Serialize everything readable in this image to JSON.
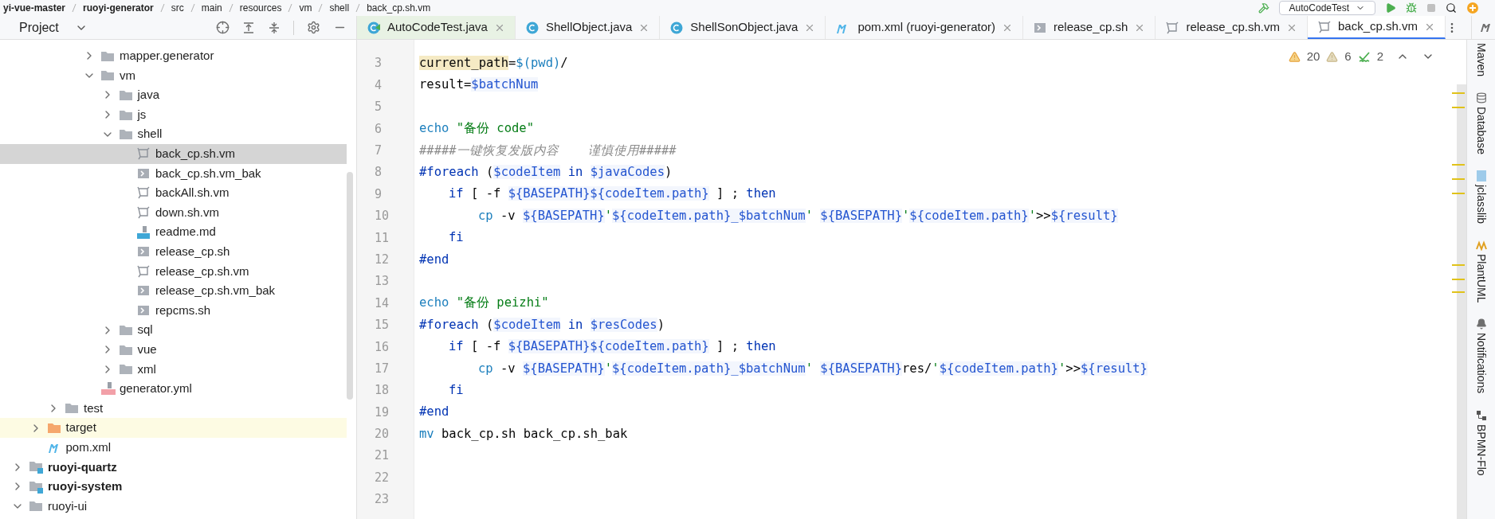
{
  "breadcrumb": [
    "yi-vue-master",
    "ruoyi-generator",
    "src",
    "main",
    "resources",
    "vm",
    "shell",
    "back_cp.sh.vm"
  ],
  "run_config": "AutoCodeTest",
  "project_panel": {
    "title": "Project"
  },
  "tree": [
    {
      "children": [
        {
          "children": [
            {
              "children": [
                {
                  "children": [
                    {
                      "label": "mapper.generator",
                      "kind": "folder",
                      "expanded": false,
                      "selected": false
                    },
                    {
                      "label": "vm",
                      "kind": "folder",
                      "expanded": true,
                      "selected": false,
                      "children": [
                        {
                          "label": "java",
                          "kind": "folder",
                          "expanded": false,
                          "selected": false
                        },
                        {
                          "label": "js",
                          "kind": "folder",
                          "expanded": false,
                          "selected": false
                        },
                        {
                          "label": "shell",
                          "kind": "folder",
                          "expanded": true,
                          "selected": false,
                          "children": [
                            {
                              "label": "back_cp.sh.vm",
                              "kind": "velocity",
                              "selected": true
                            },
                            {
                              "label": "back_cp.sh.vm_bak",
                              "kind": "shell",
                              "selected": false
                            },
                            {
                              "label": "backAll.sh.vm",
                              "kind": "velocity",
                              "selected": false
                            },
                            {
                              "label": "down.sh.vm",
                              "kind": "velocity",
                              "selected": false
                            },
                            {
                              "label": "readme.md",
                              "kind": "markdown",
                              "selected": false
                            },
                            {
                              "label": "release_cp.sh",
                              "kind": "shell",
                              "selected": false
                            },
                            {
                              "label": "release_cp.sh.vm",
                              "kind": "velocity",
                              "selected": false
                            },
                            {
                              "label": "release_cp.sh.vm_bak",
                              "kind": "shell",
                              "selected": false
                            },
                            {
                              "label": "repcms.sh",
                              "kind": "shell",
                              "selected": false
                            }
                          ]
                        },
                        {
                          "label": "sql",
                          "kind": "folder",
                          "expanded": false,
                          "selected": false
                        },
                        {
                          "label": "vue",
                          "kind": "folder",
                          "expanded": false,
                          "selected": false
                        },
                        {
                          "label": "xml",
                          "kind": "folder",
                          "expanded": false,
                          "selected": false
                        }
                      ]
                    },
                    {
                      "label": "generator.yml",
                      "kind": "yaml",
                      "selected": false
                    }
                  ]
                }
              ]
            },
            {
              "label": "test",
              "kind": "folder",
              "expanded": false,
              "selected": false
            }
          ]
        },
        {
          "label": "target",
          "kind": "excluded",
          "expanded": false,
          "selected": false
        },
        {
          "label": "pom.xml",
          "kind": "maven",
          "selected": false
        }
      ]
    },
    {
      "label": "ruoyi-quartz",
      "kind": "module",
      "expanded": false,
      "selected": false
    },
    {
      "label": "ruoyi-system",
      "kind": "module",
      "expanded": false,
      "selected": false
    },
    {
      "label": "ruoyi-ui",
      "kind": "folder",
      "expanded": true,
      "selected": false
    }
  ],
  "tabs": [
    {
      "label": "AutoCodeTest.java",
      "kind": "java-test",
      "selected": false
    },
    {
      "label": "ShellObject.java",
      "kind": "java",
      "selected": false
    },
    {
      "label": "ShellSonObject.java",
      "kind": "java",
      "selected": false
    },
    {
      "label": "pom.xml (ruoyi-generator)",
      "kind": "maven",
      "selected": false
    },
    {
      "label": "release_cp.sh",
      "kind": "shell",
      "selected": false
    },
    {
      "label": "release_cp.sh.vm",
      "kind": "velocity",
      "selected": false
    },
    {
      "label": "back_cp.sh.vm",
      "kind": "velocity",
      "selected": true
    }
  ],
  "inspections": {
    "errors": "20",
    "warnings": "6",
    "typos": "2"
  },
  "code_lines": [
    {
      "number": "3",
      "tokens": [
        {
          "text": "current_path",
          "kind": "highlight"
        },
        {
          "text": "=",
          "kind": "plain"
        },
        {
          "text": "$(pwd)",
          "kind": "cmd"
        },
        {
          "text": "/",
          "kind": "plain"
        }
      ]
    },
    {
      "number": "4",
      "tokens": [
        {
          "text": "result=",
          "kind": "plain"
        },
        {
          "text": "$batchNum",
          "kind": "var"
        }
      ]
    },
    {
      "number": "5"
    },
    {
      "number": "6",
      "tokens": [
        {
          "text": "echo",
          "kind": "cmd"
        },
        {
          "text": " \"备份 code\"",
          "kind": "str"
        }
      ]
    },
    {
      "number": "7",
      "tokens": [
        {
          "text": "#####一键恢复发版内容    谨慎使用#####",
          "kind": "comment"
        }
      ]
    },
    {
      "number": "8",
      "tokens": [
        {
          "text": "#foreach",
          "kind": "kw"
        },
        {
          "text": " (",
          "kind": "plain"
        },
        {
          "text": "$codeItem",
          "kind": "var"
        },
        {
          "text": " in ",
          "kind": "kw"
        },
        {
          "text": "$javaCodes",
          "kind": "var"
        },
        {
          "text": ")",
          "kind": "plain"
        }
      ],
      "children": [
        {
          "number": "9",
          "tokens": [
            {
              "text": "if",
              "kind": "kw"
            },
            {
              "text": " [ -f ",
              "kind": "plain"
            },
            {
              "text": "${BASEPATH}${codeItem.path}",
              "kind": "var"
            },
            {
              "text": " ] ; ",
              "kind": "plain"
            },
            {
              "text": "then",
              "kind": "kw"
            }
          ],
          "children": [
            {
              "number": "10",
              "tokens": [
                {
                  "text": "cp",
                  "kind": "cmd"
                },
                {
                  "text": " -v ",
                  "kind": "plain"
                },
                {
                  "text": "${BASEPATH}",
                  "kind": "var"
                },
                {
                  "text": "'",
                  "kind": "str"
                },
                {
                  "text": "${codeItem.path}_$batchNum",
                  "kind": "var"
                },
                {
                  "text": "' ",
                  "kind": "str"
                },
                {
                  "text": "${BASEPATH}",
                  "kind": "var"
                },
                {
                  "text": "'",
                  "kind": "str"
                },
                {
                  "text": "${codeItem.path}",
                  "kind": "var"
                },
                {
                  "text": "'",
                  "kind": "str"
                },
                {
                  "text": ">>",
                  "kind": "plain"
                },
                {
                  "text": "${result}",
                  "kind": "var"
                }
              ]
            }
          ]
        },
        {
          "number": "11",
          "tokens": [
            {
              "text": "fi",
              "kind": "kw"
            }
          ]
        }
      ]
    },
    {
      "number": "12",
      "tokens": [
        {
          "text": "#end",
          "kind": "kw"
        }
      ]
    },
    {
      "number": "13"
    },
    {
      "number": "14",
      "tokens": [
        {
          "text": "echo",
          "kind": "cmd"
        },
        {
          "text": " \"备份 peizhi\"",
          "kind": "str"
        }
      ]
    },
    {
      "number": "15",
      "tokens": [
        {
          "text": "#foreach",
          "kind": "kw"
        },
        {
          "text": " (",
          "kind": "plain"
        },
        {
          "text": "$codeItem",
          "kind": "var"
        },
        {
          "text": " in ",
          "kind": "kw"
        },
        {
          "text": "$resCodes",
          "kind": "var"
        },
        {
          "text": ")",
          "kind": "plain"
        }
      ],
      "children": [
        {
          "number": "16",
          "tokens": [
            {
              "text": "if",
              "kind": "kw"
            },
            {
              "text": " [ -f ",
              "kind": "plain"
            },
            {
              "text": "${BASEPATH}${codeItem.path}",
              "kind": "var"
            },
            {
              "text": " ] ; ",
              "kind": "plain"
            },
            {
              "text": "then",
              "kind": "kw"
            }
          ],
          "children": [
            {
              "number": "17",
              "tokens": [
                {
                  "text": "cp",
                  "kind": "cmd"
                },
                {
                  "text": " -v ",
                  "kind": "plain"
                },
                {
                  "text": "${BASEPATH}",
                  "kind": "var"
                },
                {
                  "text": "'",
                  "kind": "str"
                },
                {
                  "text": "${codeItem.path}_$batchNum",
                  "kind": "var"
                },
                {
                  "text": "' ",
                  "kind": "str"
                },
                {
                  "text": "${BASEPATH}",
                  "kind": "var"
                },
                {
                  "text": "res/",
                  "kind": "plain"
                },
                {
                  "text": "'",
                  "kind": "str"
                },
                {
                  "text": "${codeItem.path}",
                  "kind": "var"
                },
                {
                  "text": "'",
                  "kind": "str"
                },
                {
                  "text": ">>",
                  "kind": "plain"
                },
                {
                  "text": "${result}",
                  "kind": "var"
                }
              ]
            }
          ]
        },
        {
          "number": "18",
          "tokens": [
            {
              "text": "fi",
              "kind": "kw"
            }
          ]
        }
      ]
    },
    {
      "number": "19",
      "tokens": [
        {
          "text": "#end",
          "kind": "kw"
        }
      ]
    },
    {
      "number": "20",
      "tokens": [
        {
          "text": "mv",
          "kind": "cmd"
        },
        {
          "text": " back_cp.sh back_cp.sh_bak",
          "kind": "plain"
        }
      ]
    },
    {
      "number": "21"
    },
    {
      "number": "22"
    },
    {
      "number": "23"
    }
  ],
  "tool_windows": [
    "Maven",
    "Database",
    "jclasslib",
    "PlantUML",
    "Notifications",
    "BPMN-Flo"
  ]
}
